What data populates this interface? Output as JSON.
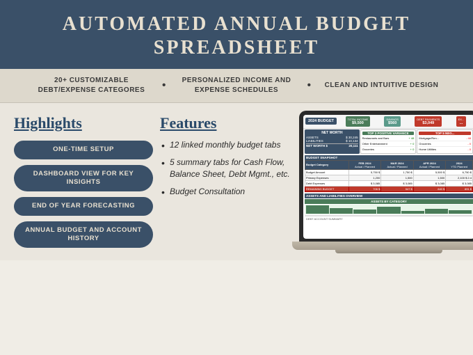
{
  "header": {
    "title_line1": "AUTOMATED ANNUAL BUDGET",
    "title_line2": "SPREADSHEET"
  },
  "features_strip": {
    "item1": "20+ CUSTOMIZABLE DEBT/EXPENSE CATEGORES",
    "item2": "PERSONALIZED INCOME AND EXPENSE SCHEDULES",
    "item3": "CLEAN AND INTUITIVE DESIGN"
  },
  "highlights": {
    "section_title": "Highlights",
    "buttons": [
      "ONE-TIME SETUP",
      "DASHBOARD VIEW FOR KEY INSIGHTS",
      "END OF YEAR FORECASTING",
      "ANNUAL BUDGET AND ACCOUNT HISTORY"
    ]
  },
  "features": {
    "section_title": "Features",
    "items": [
      "12 linked monthly budget tabs",
      "5 summary tabs for Cash Flow, Balance Sheet, Debt Mgmt., etc.",
      "Budget Consultation"
    ]
  },
  "spreadsheet": {
    "year_label": "2024 BUDGET",
    "total_income_label": "TOTAL INCOME",
    "total_income_value": "$9,500",
    "savings_label": "SAVINGS",
    "savings_value": "$560",
    "debt_payments_label": "DEBT PAYMENTS",
    "debt_payments_value": "$3,049",
    "net_worth_label": "NET WORTH",
    "assets_label": "ASSETS",
    "liabilities_label": "LIABILITIES",
    "top_variance_title": "TOP 3 POSITIVE VARIANCE",
    "top_negative_title": "TOP 5 NEG...",
    "variance_items": [
      "Restaurants and Bars",
      "Other Entertainment",
      "Groceries"
    ],
    "negative_items": [
      "Mortgage/Ren...",
      "Groceries",
      "Home Utilities"
    ],
    "budget_snapshot_title": "BUDGET SNAPSHOT",
    "months": [
      "FEB 2024",
      "MAR 2024",
      "APR 2024",
      "2024"
    ],
    "assets_overview_title": "ASSETS AND LIABILITIES OVERVIEW",
    "assets_by_category": "ASSETS BY CATEGORY"
  }
}
